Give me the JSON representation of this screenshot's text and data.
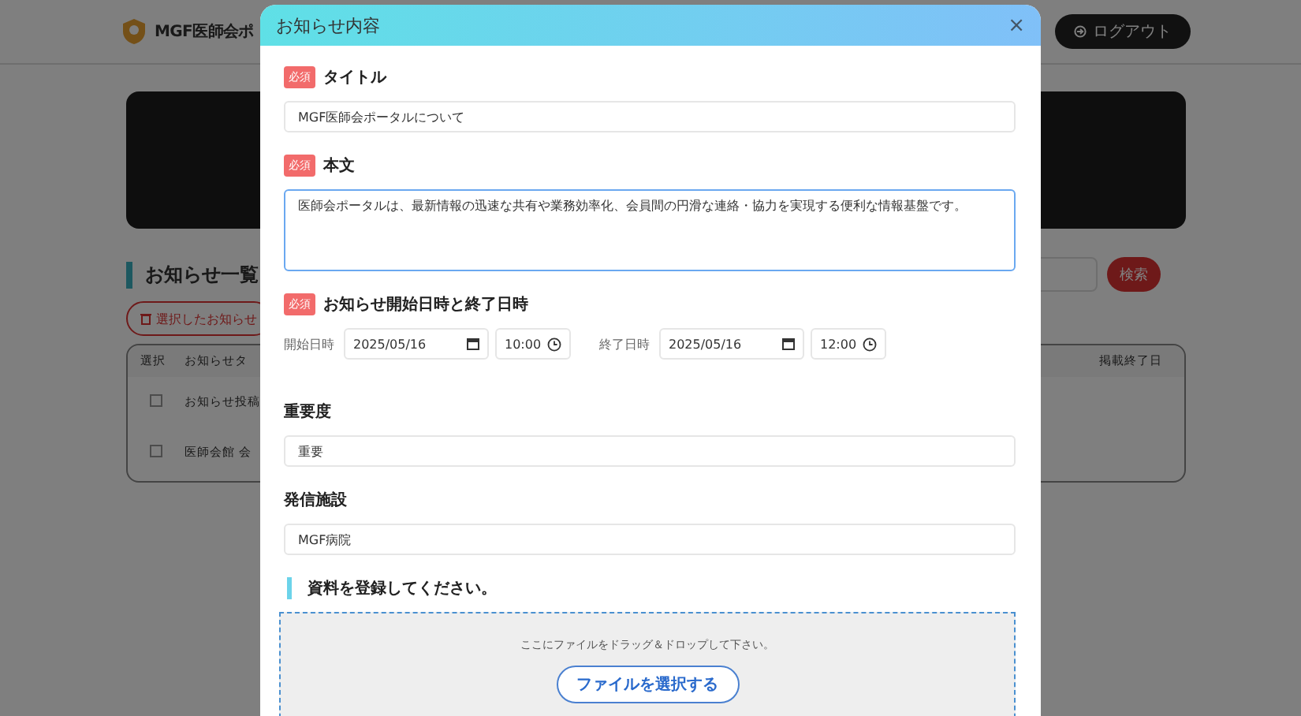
{
  "header": {
    "logo_text": "MGF医師会ポ",
    "logout_button": "ログアウト"
  },
  "page": {
    "section_title": "お知らせ一覧",
    "delete_button": "選択したお知らせ",
    "search_button": "検索",
    "table": {
      "columns": [
        "選択",
        "お知らせタ",
        "掲載終了日"
      ],
      "rows": [
        {
          "checked": false,
          "title": "お知らせ投稿"
        },
        {
          "checked": false,
          "title": "医師会館 会"
        }
      ]
    }
  },
  "modal": {
    "title": "お知らせ内容",
    "close": "×",
    "fields": [
      {
        "kind": "text",
        "label": "タイトル",
        "badge": "必須",
        "value": "MGF医師会ポータルについて"
      },
      {
        "kind": "textarea",
        "label": "本文",
        "badge": "必須",
        "focused": true,
        "value": "医師会ポータルは、最新情報の迅速な共有や業務効率化、会員間の円滑な連絡・協力を実現する便利な情報基盤です。"
      },
      {
        "kind": "datetime",
        "label": "お知らせ開始日時と終了日時",
        "badge": "必須",
        "parts": [
          {
            "label": "開始日時",
            "date": "2025/05/16",
            "time": "10:00"
          },
          {
            "label": "終了日時",
            "date": "2025/05/16",
            "time": "12:00"
          }
        ]
      },
      {
        "kind": "text",
        "label": "重要度",
        "value": "重要"
      },
      {
        "kind": "text",
        "label": "発信施設",
        "value": "MGF病院"
      }
    ],
    "upload": {
      "heading": "資料を登録してください。",
      "hint": "ここにファイルをドラッグ＆ドロップして下さい。",
      "button": "ファイルを選択する"
    }
  }
}
